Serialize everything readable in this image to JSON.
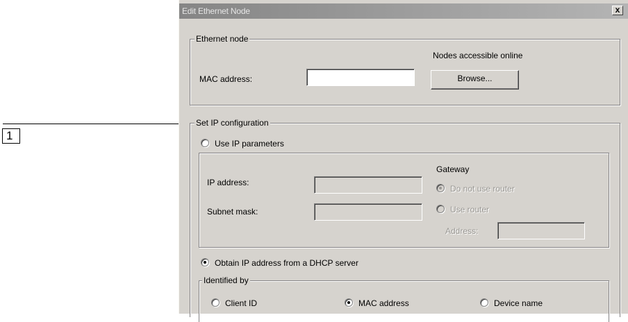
{
  "callout": {
    "label": "1"
  },
  "dialog": {
    "title": "Edit Ethernet Node",
    "close_glyph": "x",
    "ethernet_node": {
      "legend": "Ethernet node",
      "nodes_online_label": "Nodes accessible online",
      "mac_label": "MAC address:",
      "mac_value": "",
      "browse_button": "Browse..."
    },
    "ip_config": {
      "legend": "Set IP configuration",
      "use_ip_params": {
        "label": "Use IP parameters",
        "checked": false
      },
      "ip_address_label": "IP address:",
      "subnet_mask_label": "Subnet mask:",
      "gateway": {
        "title": "Gateway",
        "do_not_use_router": {
          "label": "Do not use router",
          "checked": true,
          "disabled": true
        },
        "use_router": {
          "label": "Use router",
          "checked": false,
          "disabled": true
        },
        "address_label": "Address:"
      },
      "dhcp": {
        "label": "Obtain IP address from a DHCP server",
        "checked": true
      },
      "identified_by": {
        "legend": "Identified by",
        "client_id": {
          "label": "Client ID",
          "checked": false
        },
        "mac_address": {
          "label": "MAC address",
          "checked": true
        },
        "device_name": {
          "label": "Device name",
          "checked": false
        }
      }
    }
  },
  "colors": {
    "dialog_bg": "#d6d3ce",
    "titlebar_inactive": "#858585",
    "disabled_text": "#9a9894"
  }
}
